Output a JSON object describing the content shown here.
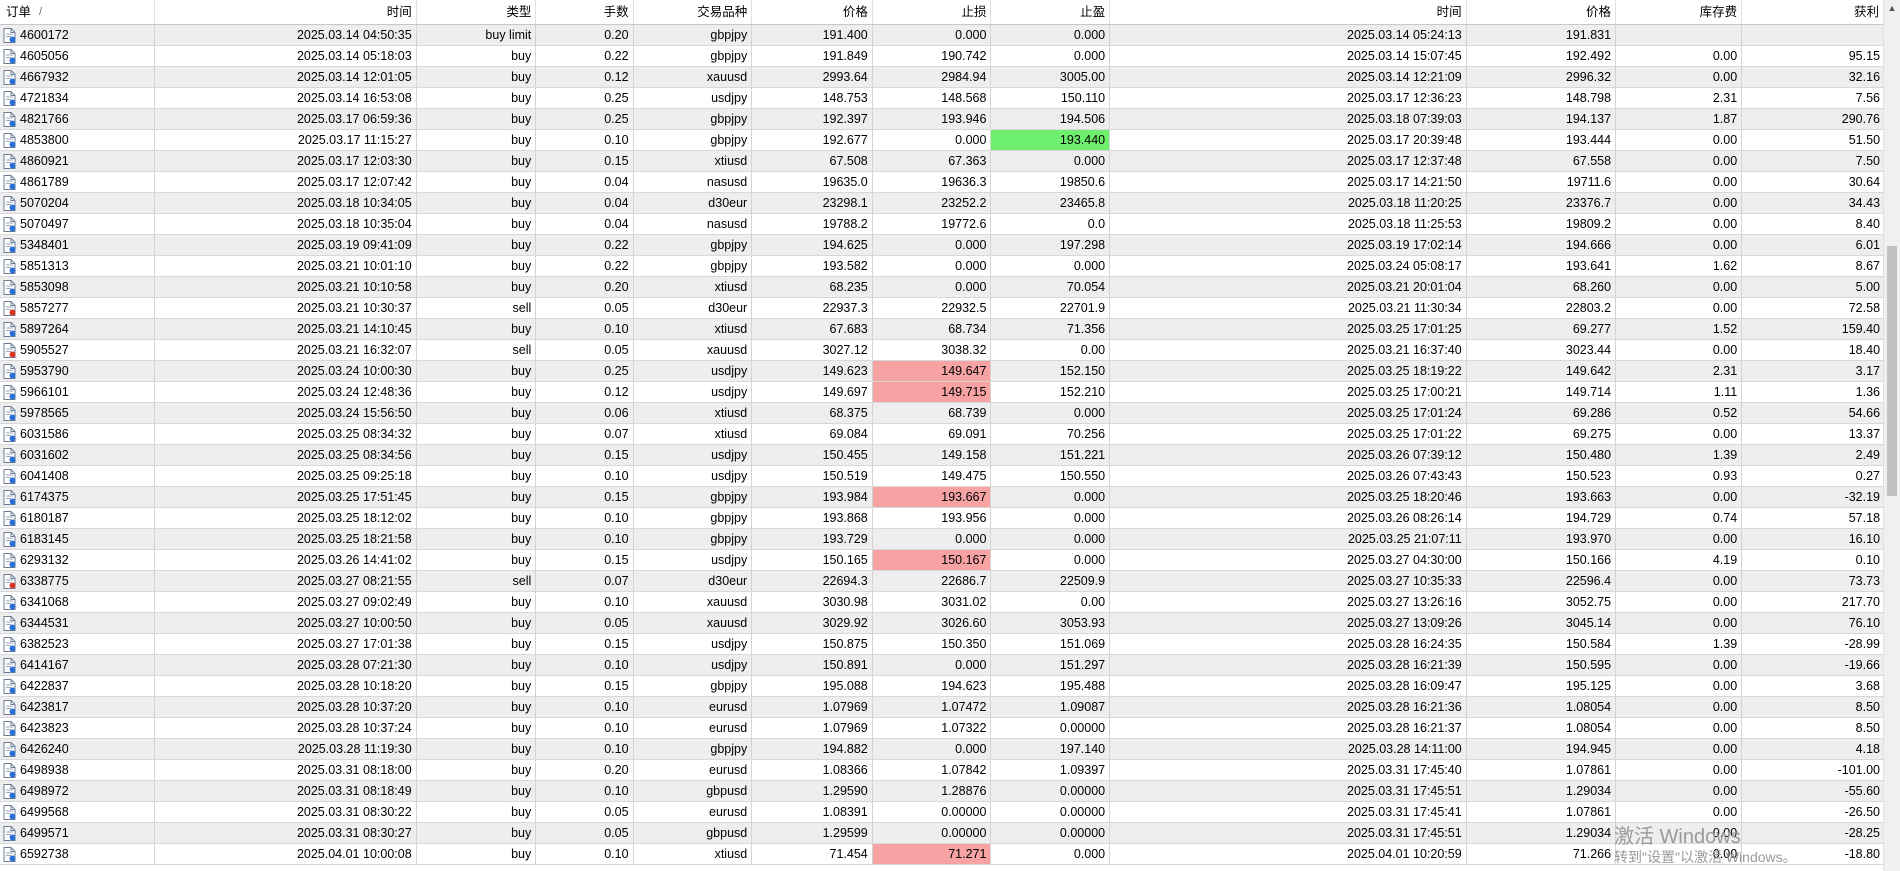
{
  "headers": [
    "订单",
    "时间",
    "类型",
    "手数",
    "交易品种",
    "价格",
    "止损",
    "止盈",
    "时间",
    "价格",
    "库存费",
    "获利"
  ],
  "sort_indicator": "/",
  "colors": {
    "row_alt": "#eeeeee",
    "sl_highlight": "#f7a3a3",
    "tp_highlight": "#6ef06e",
    "buy_icon": "#2a6fd6",
    "sell_icon": "#d9341f"
  },
  "rows": [
    {
      "order": "4600172",
      "open_time": "2025.03.14 04:50:35",
      "type": "buy limit",
      "lots": "0.20",
      "symbol": "gbpjpy",
      "price": "191.400",
      "sl": "0.000",
      "tp": "0.000",
      "close_time": "2025.03.14 05:24:13",
      "close_price": "191.831",
      "swap": "",
      "profit": "",
      "icon": "buy"
    },
    {
      "order": "4605056",
      "open_time": "2025.03.14 05:18:03",
      "type": "buy",
      "lots": "0.22",
      "symbol": "gbpjpy",
      "price": "191.849",
      "sl": "190.742",
      "tp": "0.000",
      "close_time": "2025.03.14 15:07:45",
      "close_price": "192.492",
      "swap": "0.00",
      "profit": "95.15",
      "icon": "buy"
    },
    {
      "order": "4667932",
      "open_time": "2025.03.14 12:01:05",
      "type": "buy",
      "lots": "0.12",
      "symbol": "xauusd",
      "price": "2993.64",
      "sl": "2984.94",
      "tp": "3005.00",
      "close_time": "2025.03.14 12:21:09",
      "close_price": "2996.32",
      "swap": "0.00",
      "profit": "32.16",
      "icon": "buy"
    },
    {
      "order": "4721834",
      "open_time": "2025.03.14 16:53:08",
      "type": "buy",
      "lots": "0.25",
      "symbol": "usdjpy",
      "price": "148.753",
      "sl": "148.568",
      "tp": "150.110",
      "close_time": "2025.03.17 12:36:23",
      "close_price": "148.798",
      "swap": "2.31",
      "profit": "7.56",
      "icon": "buy"
    },
    {
      "order": "4821766",
      "open_time": "2025.03.17 06:59:36",
      "type": "buy",
      "lots": "0.25",
      "symbol": "gbpjpy",
      "price": "192.397",
      "sl": "193.946",
      "tp": "194.506",
      "close_time": "2025.03.18 07:39:03",
      "close_price": "194.137",
      "swap": "1.87",
      "profit": "290.76",
      "icon": "buy"
    },
    {
      "order": "4853800",
      "open_time": "2025.03.17 11:15:27",
      "type": "buy",
      "lots": "0.10",
      "symbol": "gbpjpy",
      "price": "192.677",
      "sl": "0.000",
      "tp": "193.440",
      "close_time": "2025.03.17 20:39:48",
      "close_price": "193.444",
      "swap": "0.00",
      "profit": "51.50",
      "icon": "buy",
      "hl": "tp"
    },
    {
      "order": "4860921",
      "open_time": "2025.03.17 12:03:30",
      "type": "buy",
      "lots": "0.15",
      "symbol": "xtiusd",
      "price": "67.508",
      "sl": "67.363",
      "tp": "0.000",
      "close_time": "2025.03.17 12:37:48",
      "close_price": "67.558",
      "swap": "0.00",
      "profit": "7.50",
      "icon": "buy"
    },
    {
      "order": "4861789",
      "open_time": "2025.03.17 12:07:42",
      "type": "buy",
      "lots": "0.04",
      "symbol": "nasusd",
      "price": "19635.0",
      "sl": "19636.3",
      "tp": "19850.6",
      "close_time": "2025.03.17 14:21:50",
      "close_price": "19711.6",
      "swap": "0.00",
      "profit": "30.64",
      "icon": "buy"
    },
    {
      "order": "5070204",
      "open_time": "2025.03.18 10:34:05",
      "type": "buy",
      "lots": "0.04",
      "symbol": "d30eur",
      "price": "23298.1",
      "sl": "23252.2",
      "tp": "23465.8",
      "close_time": "2025.03.18 11:20:25",
      "close_price": "23376.7",
      "swap": "0.00",
      "profit": "34.43",
      "icon": "buy"
    },
    {
      "order": "5070497",
      "open_time": "2025.03.18 10:35:04",
      "type": "buy",
      "lots": "0.04",
      "symbol": "nasusd",
      "price": "19788.2",
      "sl": "19772.6",
      "tp": "0.0",
      "close_time": "2025.03.18 11:25:53",
      "close_price": "19809.2",
      "swap": "0.00",
      "profit": "8.40",
      "icon": "buy"
    },
    {
      "order": "5348401",
      "open_time": "2025.03.19 09:41:09",
      "type": "buy",
      "lots": "0.22",
      "symbol": "gbpjpy",
      "price": "194.625",
      "sl": "0.000",
      "tp": "197.298",
      "close_time": "2025.03.19 17:02:14",
      "close_price": "194.666",
      "swap": "0.00",
      "profit": "6.01",
      "icon": "buy"
    },
    {
      "order": "5851313",
      "open_time": "2025.03.21 10:01:10",
      "type": "buy",
      "lots": "0.22",
      "symbol": "gbpjpy",
      "price": "193.582",
      "sl": "0.000",
      "tp": "0.000",
      "close_time": "2025.03.24 05:08:17",
      "close_price": "193.641",
      "swap": "1.62",
      "profit": "8.67",
      "icon": "buy"
    },
    {
      "order": "5853098",
      "open_time": "2025.03.21 10:10:58",
      "type": "buy",
      "lots": "0.20",
      "symbol": "xtiusd",
      "price": "68.235",
      "sl": "0.000",
      "tp": "70.054",
      "close_time": "2025.03.21 20:01:04",
      "close_price": "68.260",
      "swap": "0.00",
      "profit": "5.00",
      "icon": "buy"
    },
    {
      "order": "5857277",
      "open_time": "2025.03.21 10:30:37",
      "type": "sell",
      "lots": "0.05",
      "symbol": "d30eur",
      "price": "22937.3",
      "sl": "22932.5",
      "tp": "22701.9",
      "close_time": "2025.03.21 11:30:34",
      "close_price": "22803.2",
      "swap": "0.00",
      "profit": "72.58",
      "icon": "sell"
    },
    {
      "order": "5897264",
      "open_time": "2025.03.21 14:10:45",
      "type": "buy",
      "lots": "0.10",
      "symbol": "xtiusd",
      "price": "67.683",
      "sl": "68.734",
      "tp": "71.356",
      "close_time": "2025.03.25 17:01:25",
      "close_price": "69.277",
      "swap": "1.52",
      "profit": "159.40",
      "icon": "buy"
    },
    {
      "order": "5905527",
      "open_time": "2025.03.21 16:32:07",
      "type": "sell",
      "lots": "0.05",
      "symbol": "xauusd",
      "price": "3027.12",
      "sl": "3038.32",
      "tp": "0.00",
      "close_time": "2025.03.21 16:37:40",
      "close_price": "3023.44",
      "swap": "0.00",
      "profit": "18.40",
      "icon": "sell"
    },
    {
      "order": "5953790",
      "open_time": "2025.03.24 10:00:30",
      "type": "buy",
      "lots": "0.25",
      "symbol": "usdjpy",
      "price": "149.623",
      "sl": "149.647",
      "tp": "152.150",
      "close_time": "2025.03.25 18:19:22",
      "close_price": "149.642",
      "swap": "2.31",
      "profit": "3.17",
      "icon": "buy",
      "hl": "sl"
    },
    {
      "order": "5966101",
      "open_time": "2025.03.24 12:48:36",
      "type": "buy",
      "lots": "0.12",
      "symbol": "usdjpy",
      "price": "149.697",
      "sl": "149.715",
      "tp": "152.210",
      "close_time": "2025.03.25 17:00:21",
      "close_price": "149.714",
      "swap": "1.11",
      "profit": "1.36",
      "icon": "buy",
      "hl": "sl"
    },
    {
      "order": "5978565",
      "open_time": "2025.03.24 15:56:50",
      "type": "buy",
      "lots": "0.06",
      "symbol": "xtiusd",
      "price": "68.375",
      "sl": "68.739",
      "tp": "0.000",
      "close_time": "2025.03.25 17:01:24",
      "close_price": "69.286",
      "swap": "0.52",
      "profit": "54.66",
      "icon": "buy"
    },
    {
      "order": "6031586",
      "open_time": "2025.03.25 08:34:32",
      "type": "buy",
      "lots": "0.07",
      "symbol": "xtiusd",
      "price": "69.084",
      "sl": "69.091",
      "tp": "70.256",
      "close_time": "2025.03.25 17:01:22",
      "close_price": "69.275",
      "swap": "0.00",
      "profit": "13.37",
      "icon": "buy"
    },
    {
      "order": "6031602",
      "open_time": "2025.03.25 08:34:56",
      "type": "buy",
      "lots": "0.15",
      "symbol": "usdjpy",
      "price": "150.455",
      "sl": "149.158",
      "tp": "151.221",
      "close_time": "2025.03.26 07:39:12",
      "close_price": "150.480",
      "swap": "1.39",
      "profit": "2.49",
      "icon": "buy"
    },
    {
      "order": "6041408",
      "open_time": "2025.03.25 09:25:18",
      "type": "buy",
      "lots": "0.10",
      "symbol": "usdjpy",
      "price": "150.519",
      "sl": "149.475",
      "tp": "150.550",
      "close_time": "2025.03.26 07:43:43",
      "close_price": "150.523",
      "swap": "0.93",
      "profit": "0.27",
      "icon": "buy"
    },
    {
      "order": "6174375",
      "open_time": "2025.03.25 17:51:45",
      "type": "buy",
      "lots": "0.15",
      "symbol": "gbpjpy",
      "price": "193.984",
      "sl": "193.667",
      "tp": "0.000",
      "close_time": "2025.03.25 18:20:46",
      "close_price": "193.663",
      "swap": "0.00",
      "profit": "-32.19",
      "icon": "buy",
      "hl": "sl"
    },
    {
      "order": "6180187",
      "open_time": "2025.03.25 18:12:02",
      "type": "buy",
      "lots": "0.10",
      "symbol": "gbpjpy",
      "price": "193.868",
      "sl": "193.956",
      "tp": "0.000",
      "close_time": "2025.03.26 08:26:14",
      "close_price": "194.729",
      "swap": "0.74",
      "profit": "57.18",
      "icon": "buy"
    },
    {
      "order": "6183145",
      "open_time": "2025.03.25 18:21:58",
      "type": "buy",
      "lots": "0.10",
      "symbol": "gbpjpy",
      "price": "193.729",
      "sl": "0.000",
      "tp": "0.000",
      "close_time": "2025.03.25 21:07:11",
      "close_price": "193.970",
      "swap": "0.00",
      "profit": "16.10",
      "icon": "buy"
    },
    {
      "order": "6293132",
      "open_time": "2025.03.26 14:41:02",
      "type": "buy",
      "lots": "0.15",
      "symbol": "usdjpy",
      "price": "150.165",
      "sl": "150.167",
      "tp": "0.000",
      "close_time": "2025.03.27 04:30:00",
      "close_price": "150.166",
      "swap": "4.19",
      "profit": "0.10",
      "icon": "buy",
      "hl": "sl"
    },
    {
      "order": "6338775",
      "open_time": "2025.03.27 08:21:55",
      "type": "sell",
      "lots": "0.07",
      "symbol": "d30eur",
      "price": "22694.3",
      "sl": "22686.7",
      "tp": "22509.9",
      "close_time": "2025.03.27 10:35:33",
      "close_price": "22596.4",
      "swap": "0.00",
      "profit": "73.73",
      "icon": "sell"
    },
    {
      "order": "6341068",
      "open_time": "2025.03.27 09:02:49",
      "type": "buy",
      "lots": "0.10",
      "symbol": "xauusd",
      "price": "3030.98",
      "sl": "3031.02",
      "tp": "0.00",
      "close_time": "2025.03.27 13:26:16",
      "close_price": "3052.75",
      "swap": "0.00",
      "profit": "217.70",
      "icon": "buy"
    },
    {
      "order": "6344531",
      "open_time": "2025.03.27 10:00:50",
      "type": "buy",
      "lots": "0.05",
      "symbol": "xauusd",
      "price": "3029.92",
      "sl": "3026.60",
      "tp": "3053.93",
      "close_time": "2025.03.27 13:09:26",
      "close_price": "3045.14",
      "swap": "0.00",
      "profit": "76.10",
      "icon": "buy"
    },
    {
      "order": "6382523",
      "open_time": "2025.03.27 17:01:38",
      "type": "buy",
      "lots": "0.15",
      "symbol": "usdjpy",
      "price": "150.875",
      "sl": "150.350",
      "tp": "151.069",
      "close_time": "2025.03.28 16:24:35",
      "close_price": "150.584",
      "swap": "1.39",
      "profit": "-28.99",
      "icon": "buy"
    },
    {
      "order": "6414167",
      "open_time": "2025.03.28 07:21:30",
      "type": "buy",
      "lots": "0.10",
      "symbol": "usdjpy",
      "price": "150.891",
      "sl": "0.000",
      "tp": "151.297",
      "close_time": "2025.03.28 16:21:39",
      "close_price": "150.595",
      "swap": "0.00",
      "profit": "-19.66",
      "icon": "buy"
    },
    {
      "order": "6422837",
      "open_time": "2025.03.28 10:18:20",
      "type": "buy",
      "lots": "0.15",
      "symbol": "gbpjpy",
      "price": "195.088",
      "sl": "194.623",
      "tp": "195.488",
      "close_time": "2025.03.28 16:09:47",
      "close_price": "195.125",
      "swap": "0.00",
      "profit": "3.68",
      "icon": "buy"
    },
    {
      "order": "6423817",
      "open_time": "2025.03.28 10:37:20",
      "type": "buy",
      "lots": "0.10",
      "symbol": "eurusd",
      "price": "1.07969",
      "sl": "1.07472",
      "tp": "1.09087",
      "close_time": "2025.03.28 16:21:36",
      "close_price": "1.08054",
      "swap": "0.00",
      "profit": "8.50",
      "icon": "buy"
    },
    {
      "order": "6423823",
      "open_time": "2025.03.28 10:37:24",
      "type": "buy",
      "lots": "0.10",
      "symbol": "eurusd",
      "price": "1.07969",
      "sl": "1.07322",
      "tp": "0.00000",
      "close_time": "2025.03.28 16:21:37",
      "close_price": "1.08054",
      "swap": "0.00",
      "profit": "8.50",
      "icon": "buy"
    },
    {
      "order": "6426240",
      "open_time": "2025.03.28 11:19:30",
      "type": "buy",
      "lots": "0.10",
      "symbol": "gbpjpy",
      "price": "194.882",
      "sl": "0.000",
      "tp": "197.140",
      "close_time": "2025.03.28 14:11:00",
      "close_price": "194.945",
      "swap": "0.00",
      "profit": "4.18",
      "icon": "buy"
    },
    {
      "order": "6498938",
      "open_time": "2025.03.31 08:18:00",
      "type": "buy",
      "lots": "0.20",
      "symbol": "eurusd",
      "price": "1.08366",
      "sl": "1.07842",
      "tp": "1.09397",
      "close_time": "2025.03.31 17:45:40",
      "close_price": "1.07861",
      "swap": "0.00",
      "profit": "-101.00",
      "icon": "buy"
    },
    {
      "order": "6498972",
      "open_time": "2025.03.31 08:18:49",
      "type": "buy",
      "lots": "0.10",
      "symbol": "gbpusd",
      "price": "1.29590",
      "sl": "1.28876",
      "tp": "0.00000",
      "close_time": "2025.03.31 17:45:51",
      "close_price": "1.29034",
      "swap": "0.00",
      "profit": "-55.60",
      "icon": "buy"
    },
    {
      "order": "6499568",
      "open_time": "2025.03.31 08:30:22",
      "type": "buy",
      "lots": "0.05",
      "symbol": "eurusd",
      "price": "1.08391",
      "sl": "0.00000",
      "tp": "0.00000",
      "close_time": "2025.03.31 17:45:41",
      "close_price": "1.07861",
      "swap": "0.00",
      "profit": "-26.50",
      "icon": "buy"
    },
    {
      "order": "6499571",
      "open_time": "2025.03.31 08:30:27",
      "type": "buy",
      "lots": "0.05",
      "symbol": "gbpusd",
      "price": "1.29599",
      "sl": "0.00000",
      "tp": "0.00000",
      "close_time": "2025.03.31 17:45:51",
      "close_price": "1.29034",
      "swap": "0.00",
      "profit": "-28.25",
      "icon": "buy"
    },
    {
      "order": "6592738",
      "open_time": "2025.04.01 10:00:08",
      "type": "buy",
      "lots": "0.10",
      "symbol": "xtiusd",
      "price": "71.454",
      "sl": "71.271",
      "tp": "0.000",
      "close_time": "2025.04.01 10:20:59",
      "close_price": "71.266",
      "swap": "0.00",
      "profit": "-18.80",
      "icon": "buy",
      "hl": "sl"
    }
  ],
  "watermark": {
    "line1": "激活 Windows",
    "line2": "转到\"设置\"以激活 Windows。"
  },
  "scrollbar": {
    "up_icon": "▲"
  }
}
